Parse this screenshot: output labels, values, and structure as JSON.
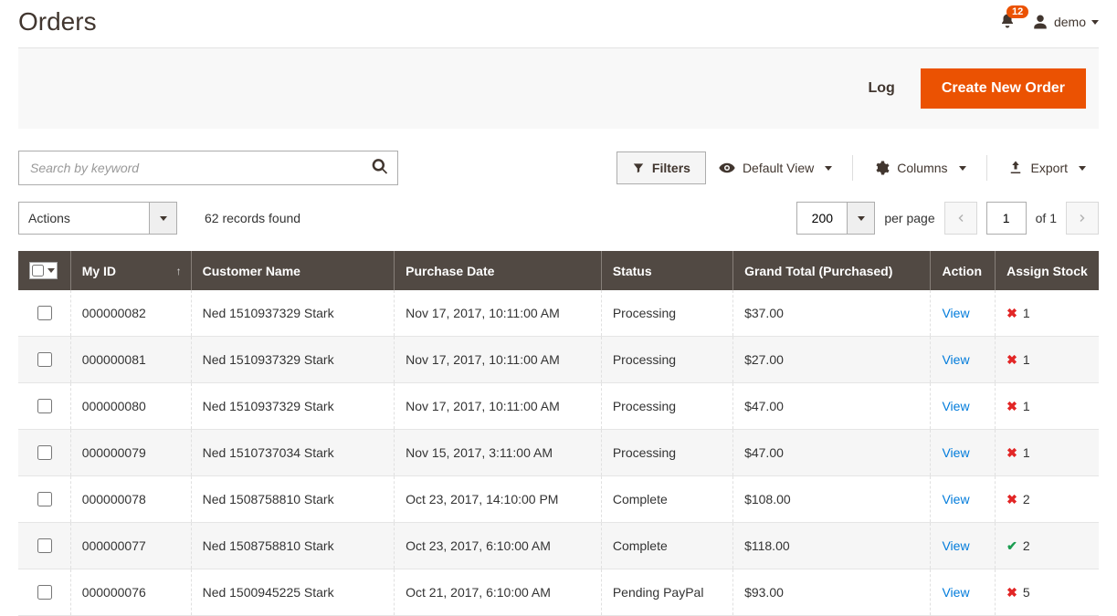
{
  "header": {
    "title": "Orders",
    "notification_count": "12",
    "user_label": "demo"
  },
  "action_bar": {
    "log_label": "Log",
    "create_label": "Create New Order"
  },
  "search": {
    "placeholder": "Search by keyword"
  },
  "toolbar": {
    "filters_label": "Filters",
    "default_view_label": "Default View",
    "columns_label": "Columns",
    "export_label": "Export"
  },
  "bulk": {
    "actions_label": "Actions",
    "records_found": "62 records found"
  },
  "pager": {
    "page_size": "200",
    "per_page_label": "per page",
    "current_page": "1",
    "of_label": "of",
    "total_pages": "1"
  },
  "grid": {
    "columns": {
      "my_id": "My ID",
      "customer": "Customer Name",
      "date": "Purchase Date",
      "status": "Status",
      "total": "Grand Total (Purchased)",
      "action": "Action",
      "stock": "Assign Stock"
    },
    "action_link_label": "View",
    "rows": [
      {
        "id": "000000082",
        "customer": "Ned 1510937329 Stark",
        "date": "Nov 17, 2017, 10:11:00 AM",
        "status": "Processing",
        "total": "$37.00",
        "stock_ok": false,
        "stock_qty": "1"
      },
      {
        "id": "000000081",
        "customer": "Ned 1510937329 Stark",
        "date": "Nov 17, 2017, 10:11:00 AM",
        "status": "Processing",
        "total": "$27.00",
        "stock_ok": false,
        "stock_qty": "1"
      },
      {
        "id": "000000080",
        "customer": "Ned 1510937329 Stark",
        "date": "Nov 17, 2017, 10:11:00 AM",
        "status": "Processing",
        "total": "$47.00",
        "stock_ok": false,
        "stock_qty": "1"
      },
      {
        "id": "000000079",
        "customer": "Ned 1510737034 Stark",
        "date": "Nov 15, 2017, 3:11:00 AM",
        "status": "Processing",
        "total": "$47.00",
        "stock_ok": false,
        "stock_qty": "1"
      },
      {
        "id": "000000078",
        "customer": "Ned 1508758810 Stark",
        "date": "Oct 23, 2017, 14:10:00 PM",
        "status": "Complete",
        "total": "$108.00",
        "stock_ok": false,
        "stock_qty": "2"
      },
      {
        "id": "000000077",
        "customer": "Ned 1508758810 Stark",
        "date": "Oct 23, 2017, 6:10:00 AM",
        "status": "Complete",
        "total": "$118.00",
        "stock_ok": true,
        "stock_qty": "2"
      },
      {
        "id": "000000076",
        "customer": "Ned 1500945225 Stark",
        "date": "Oct 21, 2017, 6:10:00 AM",
        "status": "Pending PayPal",
        "total": "$93.00",
        "stock_ok": false,
        "stock_qty": "5"
      }
    ]
  }
}
